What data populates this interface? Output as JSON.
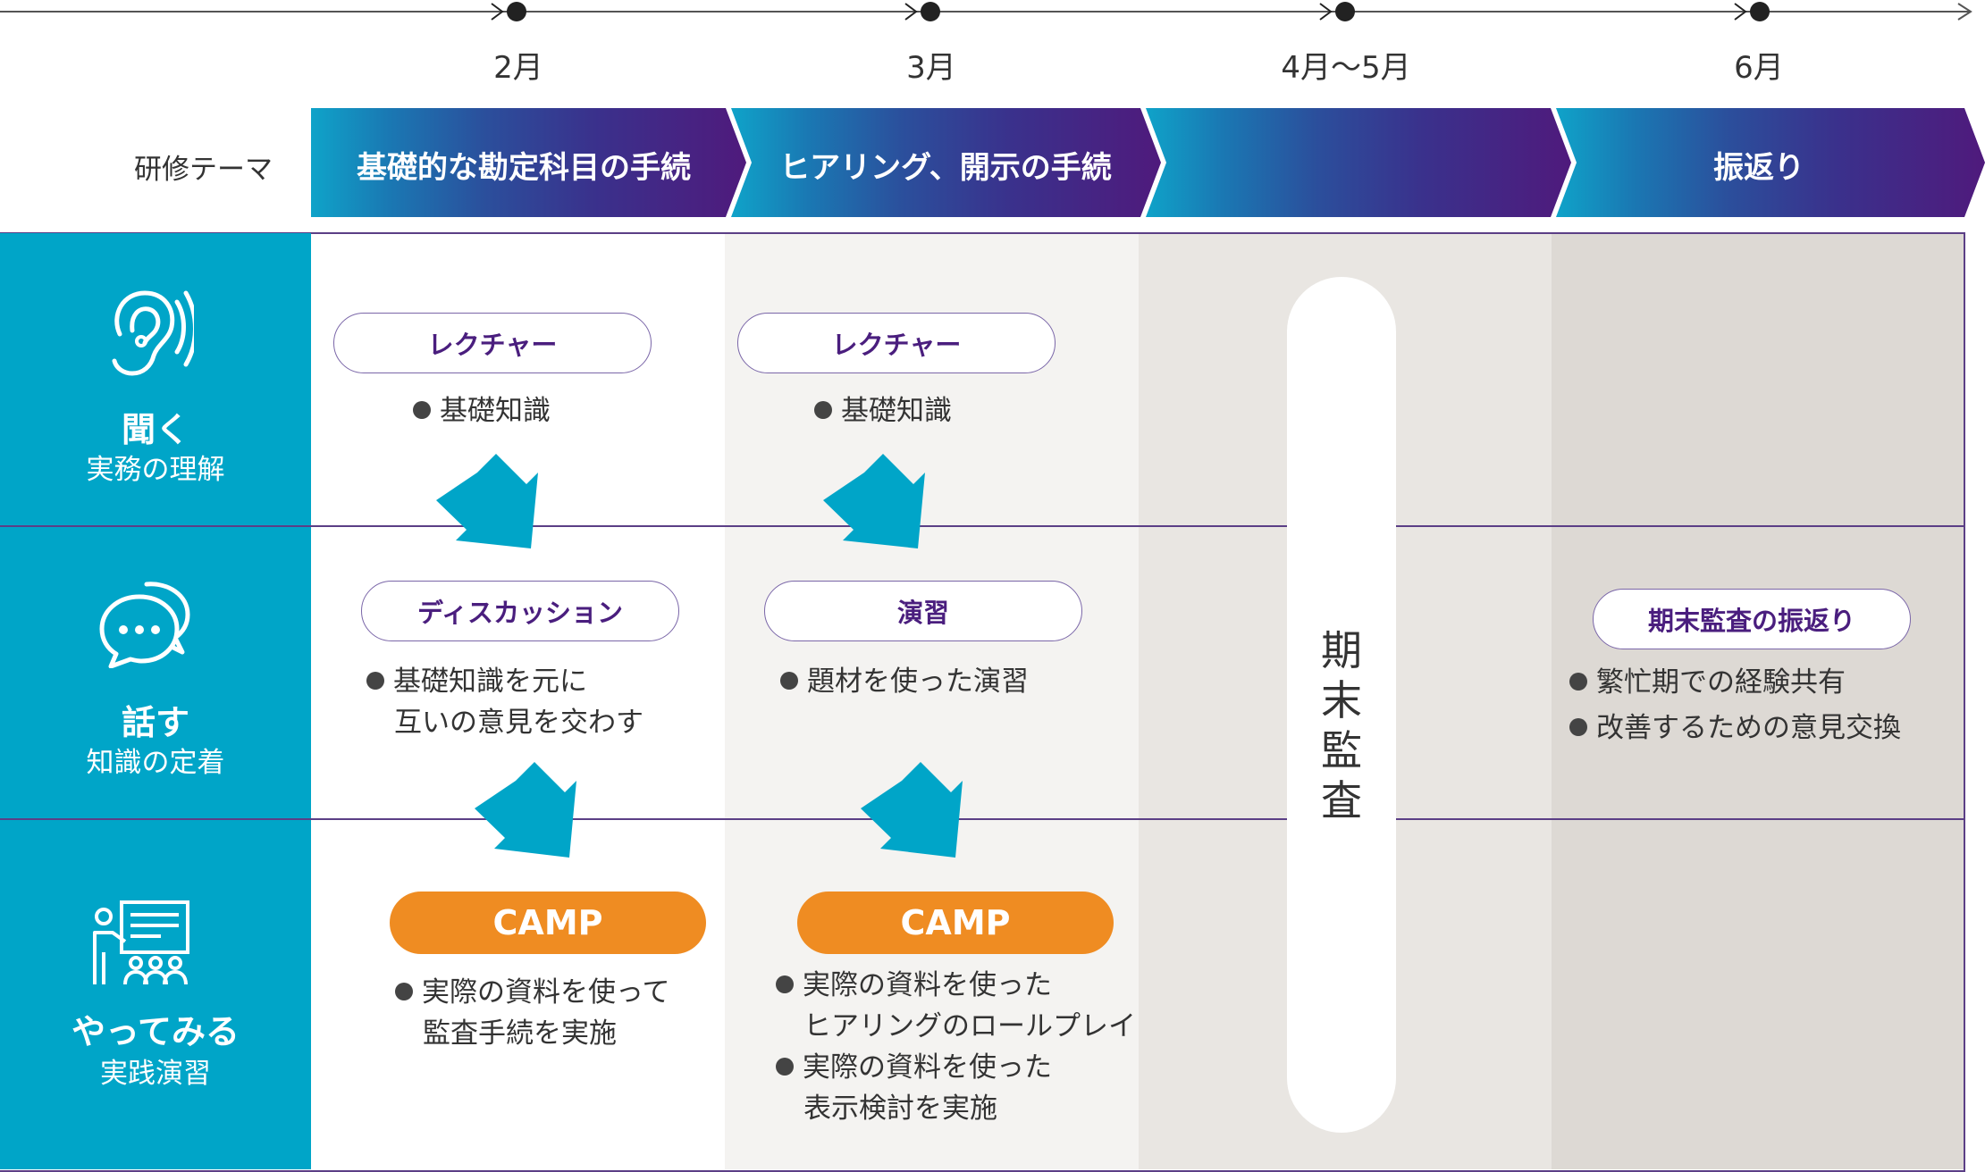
{
  "timeline": {
    "months": [
      "2月",
      "3月",
      "4月〜5月",
      "6月"
    ]
  },
  "theme": {
    "label": "研修テーマ",
    "items": [
      "基礎的な勘定科目の手続",
      "ヒアリング、開示の手続",
      "",
      "振返り"
    ]
  },
  "rows": [
    {
      "title": "聞く",
      "subtitle": "実務の理解",
      "icon": "ear-icon"
    },
    {
      "title": "話す",
      "subtitle": "知識の定着",
      "icon": "speech-bubbles-icon"
    },
    {
      "title": "やってみる",
      "subtitle": "実践演習",
      "icon": "presentation-icon"
    }
  ],
  "feb": {
    "listen_pill": "レクチャー",
    "listen_bullet": "基礎知識",
    "talk_pill": "ディスカッション",
    "talk_bullet_1": "基礎知識を元に",
    "talk_bullet_2": "互いの意見を交わす",
    "do_pill": "CAMP",
    "do_bullet_1": "実際の資料を使って",
    "do_bullet_2": "監査手続を実施"
  },
  "mar": {
    "listen_pill": "レクチャー",
    "listen_bullet": "基礎知識",
    "talk_pill": "演習",
    "talk_bullet": "題材を使った演習",
    "do_pill": "CAMP",
    "do_bullet_1a": "実際の資料を使った",
    "do_bullet_1b": "ヒアリングのロールプレイ",
    "do_bullet_2a": "実際の資料を使った",
    "do_bullet_2b": "表示検討を実施"
  },
  "aprmay": {
    "audit_label": "期末監査"
  },
  "jun": {
    "talk_pill": "期末監査の振返り",
    "bullet_1": "繁忙期での経験共有",
    "bullet_2": "改善するための意見交換"
  },
  "colors": {
    "cyan": "#00a5c8",
    "purple": "#4a1e7e",
    "orange": "#ef8c22",
    "col_feb": "#ffffff",
    "col_mar": "#f4f3f1",
    "col_aprmay": "#e9e6e2",
    "col_jun": "#ddd9d4"
  }
}
